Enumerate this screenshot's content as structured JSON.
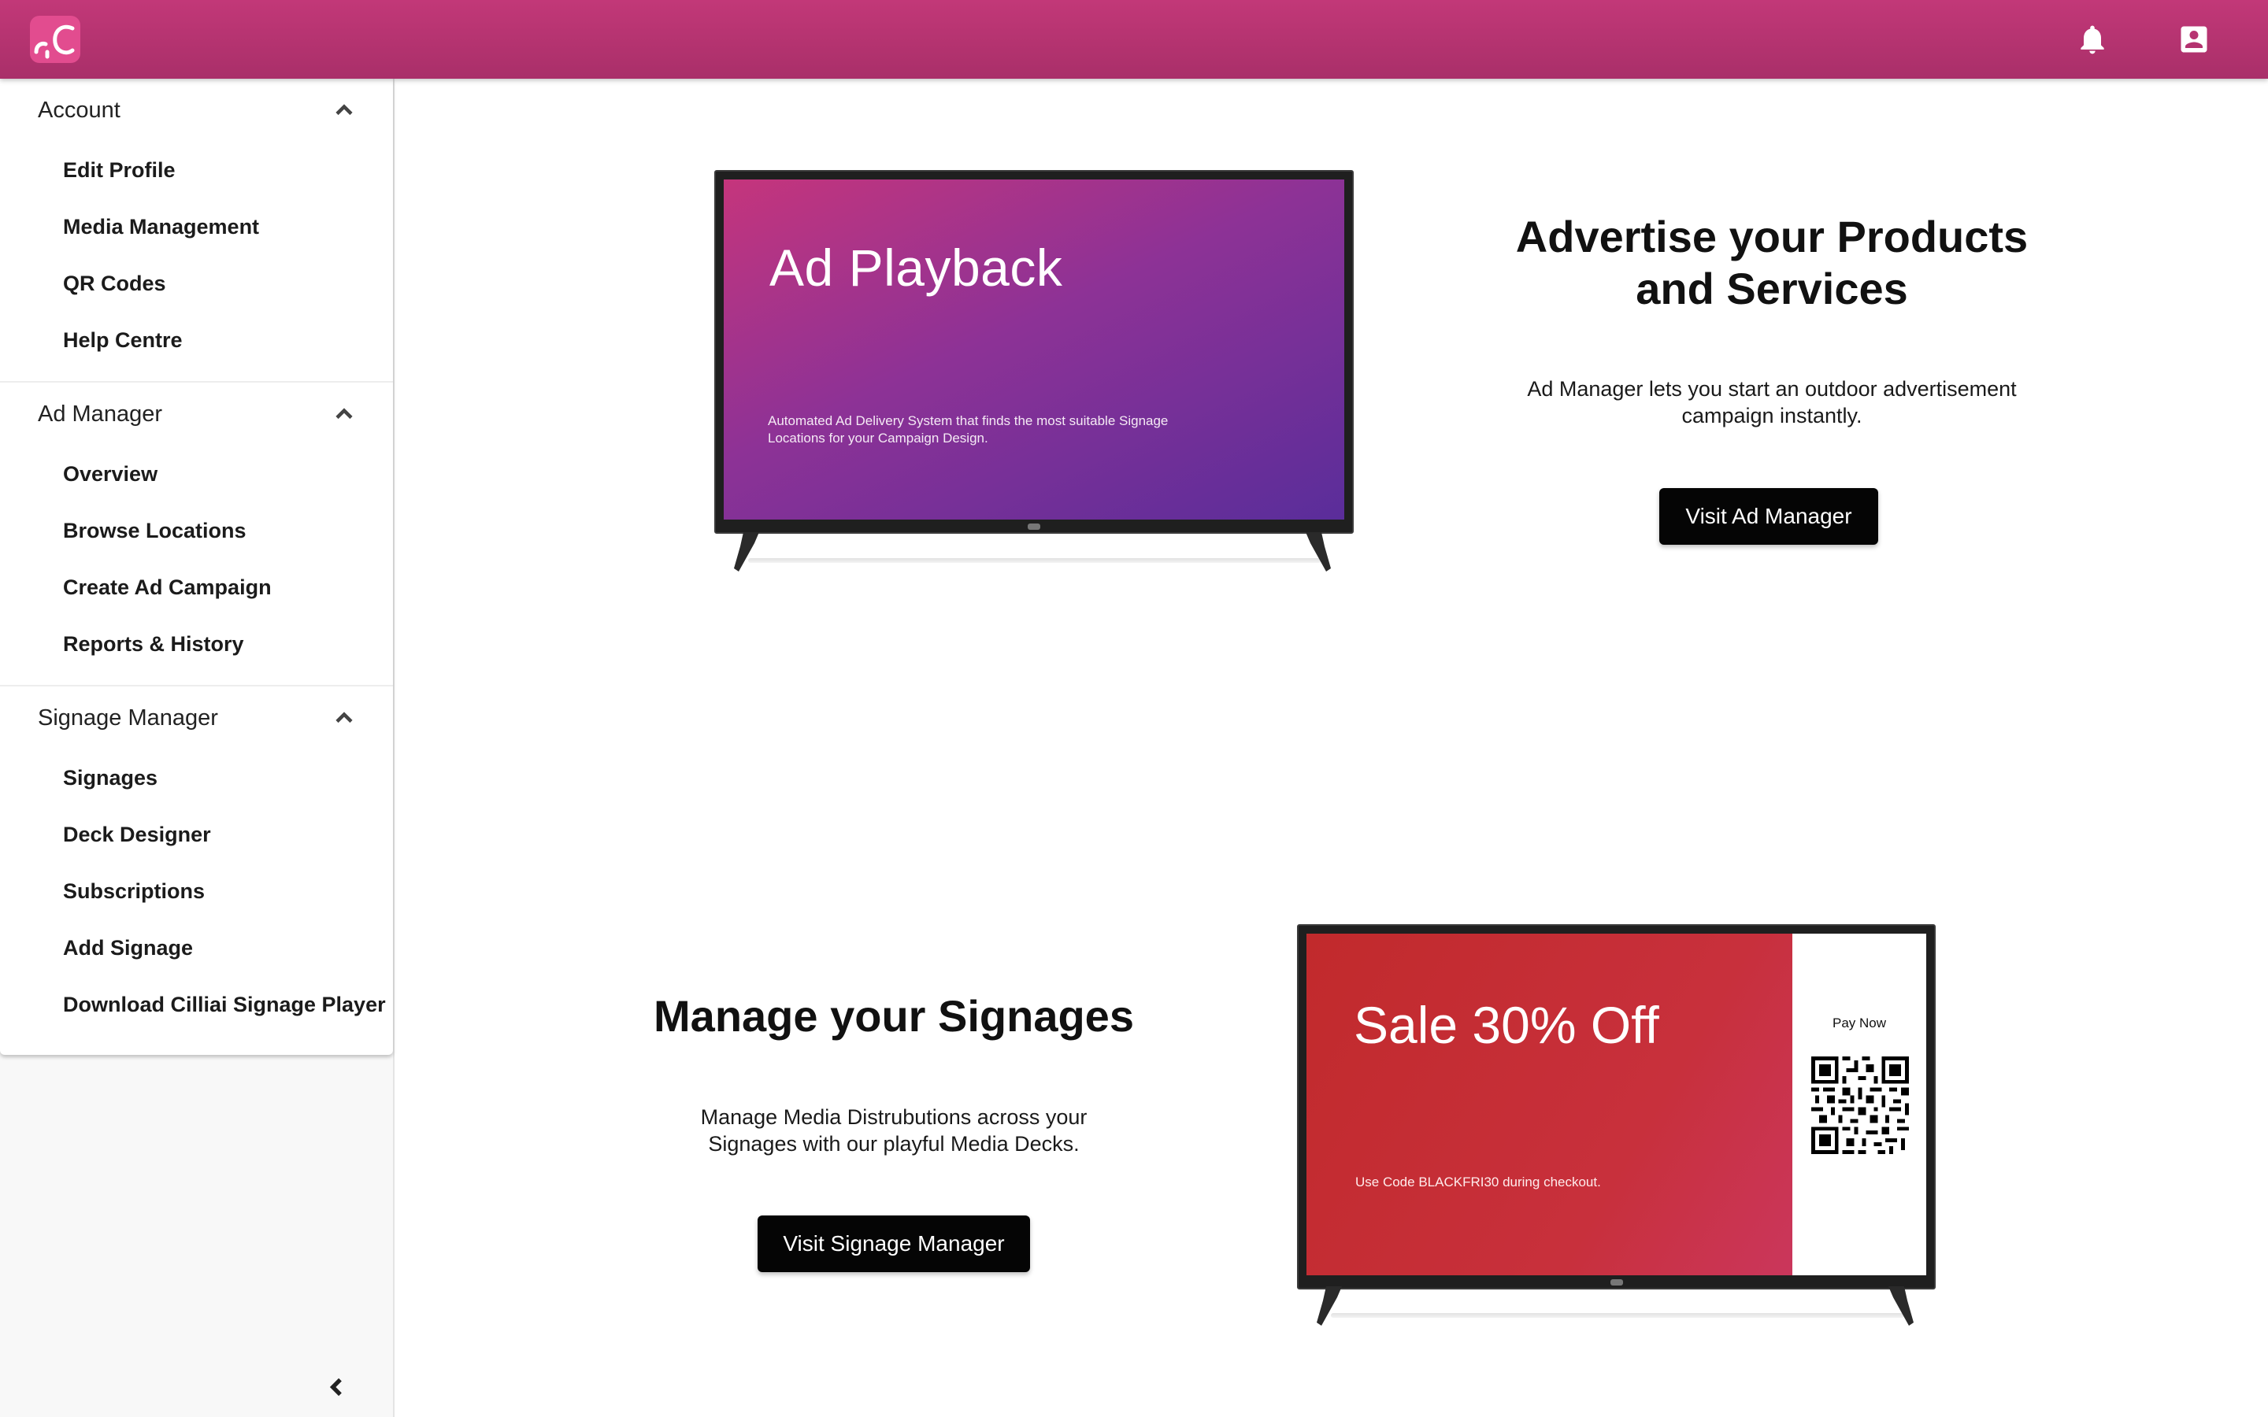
{
  "topbar": {
    "logo_icon": "cilliai-logo",
    "bell_icon": "bell-icon",
    "account_icon": "account-box-icon"
  },
  "sidebar": {
    "sections": [
      {
        "title": "Account",
        "items": [
          "Edit Profile",
          "Media Management",
          "QR Codes",
          "Help Centre"
        ]
      },
      {
        "title": "Ad Manager",
        "items": [
          "Overview",
          "Browse Locations",
          "Create Ad Campaign",
          "Reports & History"
        ]
      },
      {
        "title": "Signage Manager",
        "items": [
          "Signages",
          "Deck Designer",
          "Subscriptions",
          "Add Signage",
          "Download Cilliai Signage Player"
        ]
      }
    ],
    "collapse_icon": "chevron-left-icon"
  },
  "ad_feature": {
    "screen_title": "Ad Playback",
    "screen_desc": "Automated Ad Delivery System that finds the most suitable Signage Locations for your Campaign Design.",
    "title": "Advertise your Products and Services",
    "description": "Ad Manager lets you start an outdoor advertisement campaign instantly.",
    "button": "Visit Ad Manager"
  },
  "signage_feature": {
    "screen_title": "Sale 30% Off",
    "screen_desc": "Use Code BLACKFRI30 during checkout.",
    "pay_now": "Pay Now",
    "title": "Manage your Signages",
    "description": "Manage Media Distrubutions across your Signages with our playful Media Decks.",
    "button": "Visit Signage Manager"
  },
  "colors": {
    "brand": "#b83272",
    "button": "#050505"
  }
}
